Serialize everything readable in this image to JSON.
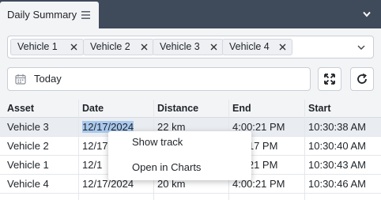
{
  "tab": {
    "title": "Daily Summary",
    "menu_icon": "hamburger-icon"
  },
  "header": {
    "collapse_icon": "chevron-down-icon"
  },
  "vehicle_filter": {
    "chips": [
      "Vehicle 1",
      "Vehicle 2",
      "Vehicle 3",
      "Vehicle 4"
    ]
  },
  "date_filter": {
    "value": "Today"
  },
  "table": {
    "columns": [
      "Asset",
      "Date",
      "Distance",
      "End",
      "Start"
    ],
    "rows": [
      {
        "asset": "Vehicle 3",
        "date": "12/17/2024",
        "distance": "22 km",
        "end": "4:00:21 PM",
        "start": "10:30:38 AM"
      },
      {
        "asset": "Vehicle 2",
        "date": "12/17",
        "distance": "",
        "end": "0:17 PM",
        "start": "10:30:40 AM"
      },
      {
        "asset": "Vehicle 1",
        "date": "12/1",
        "distance": "",
        "end": "0:21 PM",
        "start": "10:30:43 AM"
      },
      {
        "asset": "Vehicle 4",
        "date": "12/17/2024",
        "distance": "20 km",
        "end": "4:00:21 PM",
        "start": "10:30:46 AM"
      }
    ]
  },
  "context_menu": {
    "items": [
      "Show track",
      "Open in Charts"
    ]
  },
  "colors": {
    "header_bg": "#3f4a5a",
    "panel_bg": "#f3f4f6",
    "selection": "#a9c9ee"
  }
}
